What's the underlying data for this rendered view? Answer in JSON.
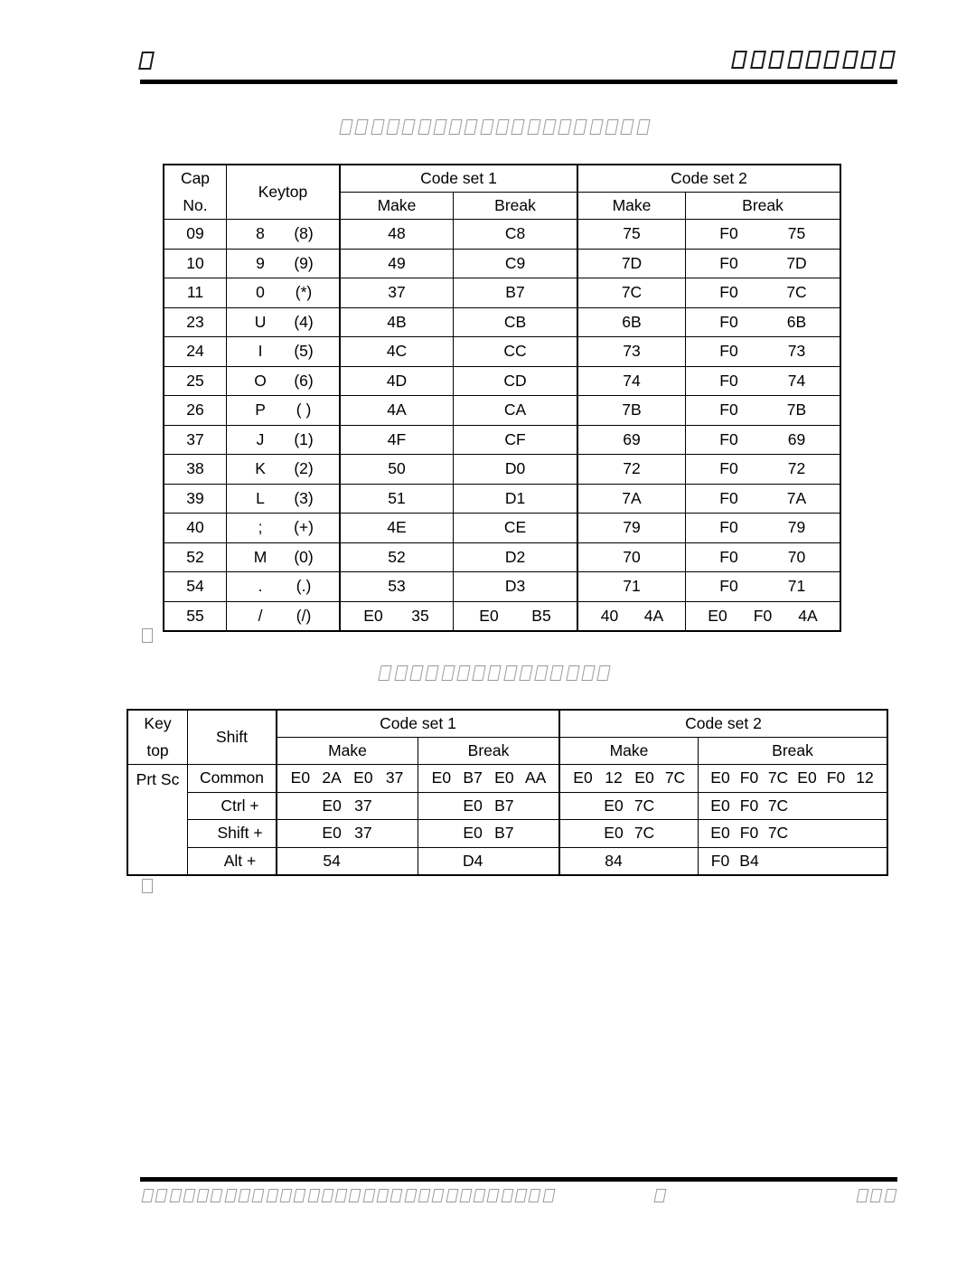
{
  "page": {
    "header": {
      "left_glyphs": 1,
      "right_glyphs": 9,
      "left_text": "█",
      "right_text": "█████████"
    },
    "footer": {
      "left_glyphs": 30,
      "middle_glyphs": 1,
      "right_glyphs": 3,
      "left_text": "██████████████████████████████",
      "middle_text": "█",
      "right_text": "███"
    }
  },
  "headings": {
    "section_1_glyphs": 20,
    "section_2_glyphs": 15
  },
  "stray_marks": {
    "after_table_1_glyphs": 1,
    "after_table_2_glyphs": 1
  },
  "table_keycodes": {
    "columns": {
      "cap_no": "Cap\nNo.",
      "cap_no_line1": "Cap",
      "cap_no_line2": "No.",
      "keytop": "Keytop",
      "code_set_1": "Code set 1",
      "code_set_2": "Code set 2",
      "make": "Make",
      "break": "Break"
    },
    "rows": [
      {
        "cap": "09",
        "key": "8",
        "alt": "(8)",
        "mk1": [
          "48"
        ],
        "bk1": [
          "C8"
        ],
        "mk2": [
          "75"
        ],
        "bk2": [
          "F0",
          "75"
        ]
      },
      {
        "cap": "10",
        "key": "9",
        "alt": "(9)",
        "mk1": [
          "49"
        ],
        "bk1": [
          "C9"
        ],
        "mk2": [
          "7D"
        ],
        "bk2": [
          "F0",
          "7D"
        ]
      },
      {
        "cap": "11",
        "key": "0",
        "alt": "(*)",
        "mk1": [
          "37"
        ],
        "bk1": [
          "B7"
        ],
        "mk2": [
          "7C"
        ],
        "bk2": [
          "F0",
          "7C"
        ]
      },
      {
        "cap": "23",
        "key": "U",
        "alt": "(4)",
        "mk1": [
          "4B"
        ],
        "bk1": [
          "CB"
        ],
        "mk2": [
          "6B"
        ],
        "bk2": [
          "F0",
          "6B"
        ]
      },
      {
        "cap": "24",
        "key": "I",
        "alt": "(5)",
        "mk1": [
          "4C"
        ],
        "bk1": [
          "CC"
        ],
        "mk2": [
          "73"
        ],
        "bk2": [
          "F0",
          "73"
        ]
      },
      {
        "cap": "25",
        "key": "O",
        "alt": "(6)",
        "mk1": [
          "4D"
        ],
        "bk1": [
          "CD"
        ],
        "mk2": [
          "74"
        ],
        "bk2": [
          "F0",
          "74"
        ]
      },
      {
        "cap": "26",
        "key": "P",
        "alt": "( )",
        "mk1": [
          "4A"
        ],
        "bk1": [
          "CA"
        ],
        "mk2": [
          "7B"
        ],
        "bk2": [
          "F0",
          "7B"
        ]
      },
      {
        "cap": "37",
        "key": "J",
        "alt": "(1)",
        "mk1": [
          "4F"
        ],
        "bk1": [
          "CF"
        ],
        "mk2": [
          "69"
        ],
        "bk2": [
          "F0",
          "69"
        ]
      },
      {
        "cap": "38",
        "key": "K",
        "alt": "(2)",
        "mk1": [
          "50"
        ],
        "bk1": [
          "D0"
        ],
        "mk2": [
          "72"
        ],
        "bk2": [
          "F0",
          "72"
        ]
      },
      {
        "cap": "39",
        "key": "L",
        "alt": "(3)",
        "mk1": [
          "51"
        ],
        "bk1": [
          "D1"
        ],
        "mk2": [
          "7A"
        ],
        "bk2": [
          "F0",
          "7A"
        ]
      },
      {
        "cap": "40",
        "key": ";",
        "alt": "(+)",
        "mk1": [
          "4E"
        ],
        "bk1": [
          "CE"
        ],
        "mk2": [
          "79"
        ],
        "bk2": [
          "F0",
          "79"
        ]
      },
      {
        "cap": "52",
        "key": "M",
        "alt": "(0)",
        "mk1": [
          "52"
        ],
        "bk1": [
          "D2"
        ],
        "mk2": [
          "70"
        ],
        "bk2": [
          "F0",
          "70"
        ]
      },
      {
        "cap": "54",
        "key": ".",
        "alt": "(.)",
        "mk1": [
          "53"
        ],
        "bk1": [
          "D3"
        ],
        "mk2": [
          "71"
        ],
        "bk2": [
          "F0",
          "71"
        ]
      },
      {
        "cap": "55",
        "key": "/",
        "alt": "(/)",
        "mk1": [
          "E0",
          "35"
        ],
        "bk1": [
          "E0",
          "B5"
        ],
        "mk2": [
          "40",
          "4A"
        ],
        "bk2": [
          "E0",
          "F0",
          "4A"
        ]
      }
    ]
  },
  "table_prtsc": {
    "columns": {
      "keytop_line1": "Key",
      "keytop_line2": "top",
      "shift": "Shift",
      "code_set_1": "Code set 1",
      "code_set_2": "Code set 2",
      "make": "Make",
      "break": "Break"
    },
    "keytop": "Prt Sc",
    "rows": [
      {
        "shift": "Common",
        "mk1": [
          "E0",
          "2A",
          "E0",
          "37"
        ],
        "bk1": [
          "E0",
          "B7",
          "E0",
          "AA"
        ],
        "mk2": [
          "E0",
          "12",
          "E0",
          "7C"
        ],
        "bk2": [
          "E0",
          "F0",
          "7C",
          "E0",
          "F0",
          "12"
        ]
      },
      {
        "shift": "Ctrl +",
        "mk1": [
          "E0",
          "37"
        ],
        "bk1": [
          "E0",
          "B7"
        ],
        "mk2": [
          "E0",
          "7C"
        ],
        "bk2": [
          "E0",
          "F0",
          "7C"
        ]
      },
      {
        "shift": "Shift +",
        "mk1": [
          "E0",
          "37"
        ],
        "bk1": [
          "E0",
          "B7"
        ],
        "mk2": [
          "E0",
          "7C"
        ],
        "bk2": [
          "E0",
          "F0",
          "7C"
        ]
      },
      {
        "shift": "Alt +",
        "mk1": [
          "54"
        ],
        "bk1": [
          "D4"
        ],
        "mk2": [
          "84"
        ],
        "bk2": [
          "F0",
          "B4"
        ]
      }
    ]
  }
}
